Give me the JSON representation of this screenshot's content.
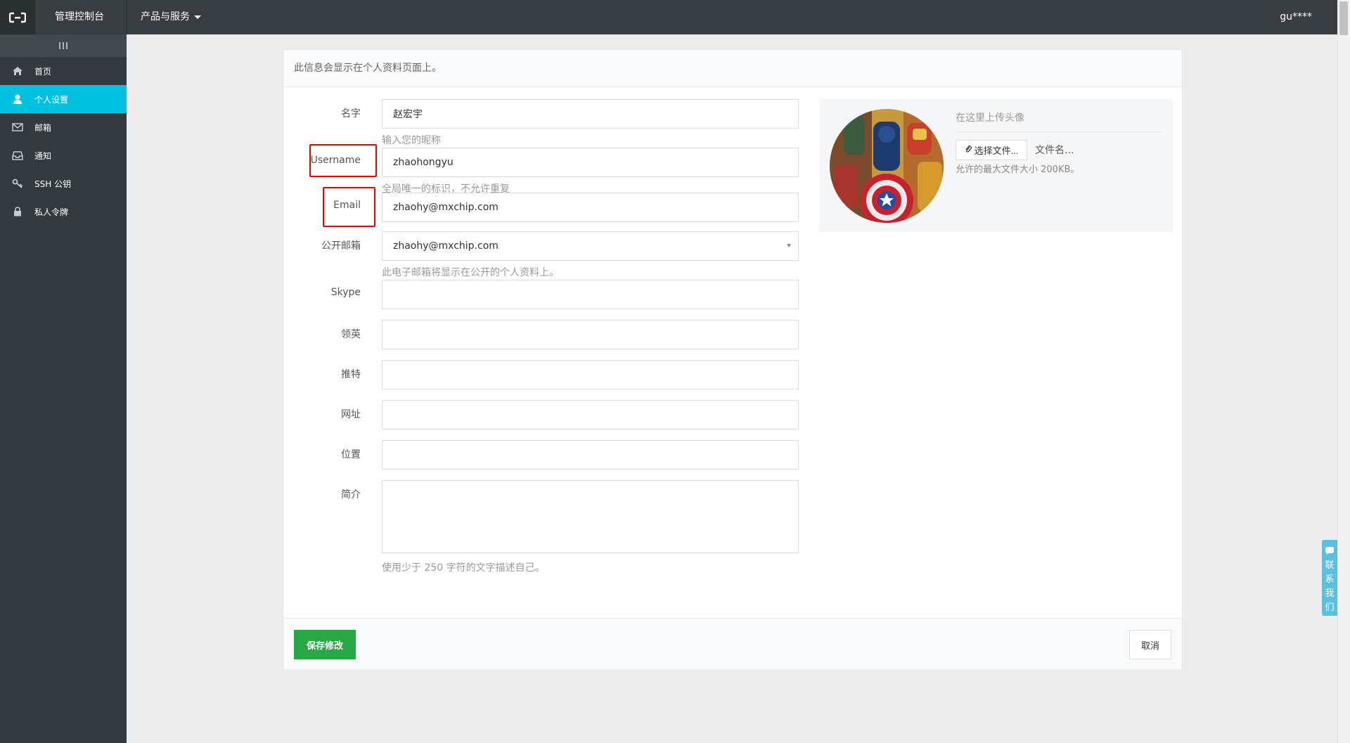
{
  "topbar": {
    "title": "管理控制台",
    "products_menu": "产品与服务",
    "user": "gu****"
  },
  "sidebar": {
    "items": [
      {
        "label": "首页",
        "icon": "home-icon",
        "active": false
      },
      {
        "label": "个人设置",
        "icon": "user-icon",
        "active": true
      },
      {
        "label": "邮箱",
        "icon": "envelope-icon",
        "active": false
      },
      {
        "label": "通知",
        "icon": "inbox-icon",
        "active": false
      },
      {
        "label": "SSH 公钥",
        "icon": "key-icon",
        "active": false
      },
      {
        "label": "私人令牌",
        "icon": "lock-icon",
        "active": false
      }
    ]
  },
  "panel": {
    "header": "此信息会显示在个人资料页面上。"
  },
  "form": {
    "name": {
      "label": "名字",
      "value": "赵宏宇",
      "help": "输入您的昵称"
    },
    "username": {
      "label": "Username",
      "value": "zhaohongyu",
      "help": "全局唯一的标识，不允许重复"
    },
    "email": {
      "label": "Email",
      "value": "zhaohy@mxchip.com"
    },
    "public_email": {
      "label": "公开邮箱",
      "value": "zhaohy@mxchip.com",
      "help": "此电子邮箱将显示在公开的个人资料上。"
    },
    "skype": {
      "label": "Skype",
      "value": ""
    },
    "linkedin": {
      "label": "领英",
      "value": ""
    },
    "twitter": {
      "label": "推特",
      "value": ""
    },
    "website": {
      "label": "网址",
      "value": ""
    },
    "location": {
      "label": "位置",
      "value": ""
    },
    "bio": {
      "label": "简介",
      "value": "",
      "help": "使用少于 250 字符的文字描述自己。"
    }
  },
  "avatar": {
    "title": "在这里上传头像",
    "choose_button": "选择文件...",
    "file_name": "文件名...",
    "size_hint": "允许的最大文件大小 200KB。"
  },
  "footer": {
    "save_label": "保存修改",
    "cancel_label": "取消"
  },
  "contact": {
    "label": "联系我们"
  },
  "colors": {
    "topbar": "#373d41",
    "sidebar": "#333a3f",
    "active_nav": "#00c1de",
    "save_button": "#28a745",
    "annotation_box": "#ee0000",
    "contact_tab": "#5bc0de"
  }
}
